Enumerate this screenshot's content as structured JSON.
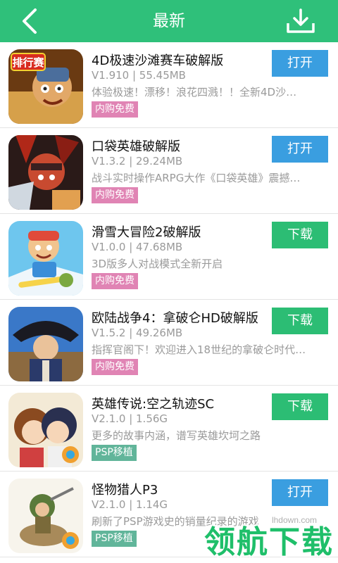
{
  "header": {
    "title": "最新",
    "back_icon": "chevron-left-icon",
    "download_icon": "download-tray-icon",
    "color": "#2fc07a"
  },
  "apps": [
    {
      "name": "4D极速沙滩赛车破解版",
      "meta": "V1.910 | 55.45MB",
      "desc": "体验极速！漂移！浪花四溅！！全新4D沙…",
      "badge": "内购免费",
      "action": "打开",
      "thumb_text": "排行赛"
    },
    {
      "name": "口袋英雄破解版",
      "meta": "V1.3.2 | 29.24MB",
      "desc": "战斗实时操作ARPG大作《口袋英雄》震撼…",
      "badge": "内购免费",
      "action": "打开"
    },
    {
      "name": "滑雪大冒险2破解版",
      "meta": "V1.0.0 | 47.68MB",
      "desc": "3D版多人对战模式全新开启",
      "badge": "内购免费",
      "action": "下载"
    },
    {
      "name": "欧陆战争4：拿破仑HD破解版",
      "meta": "V1.5.2 | 49.26MB",
      "desc": "指挥官阁下！欢迎进入18世纪的拿破仑时代…",
      "badge": "内购免费",
      "action": "下载"
    },
    {
      "name": "英雄传说:空之轨迹SC",
      "meta": "V2.1.0 | 1.56G",
      "desc": "更多的故事内涵，谱写英雄坎坷之路",
      "badge": "PSP移植",
      "action": "下载"
    },
    {
      "name": "怪物猎人P3",
      "meta": "V2.1.0 | 1.14G",
      "desc": "刷新了PSP游戏史的销量纪录的游戏",
      "badge": "PSP移植",
      "action": "打开"
    }
  ],
  "watermark": {
    "url": "lhdown.com",
    "text": "领航下载"
  }
}
